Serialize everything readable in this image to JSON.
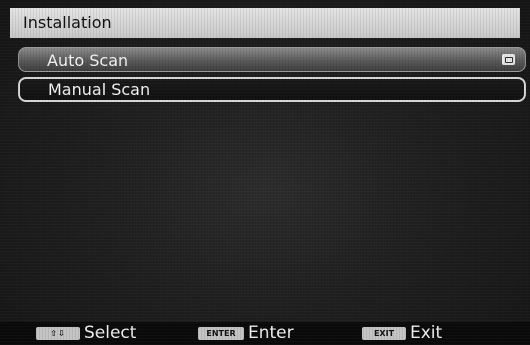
{
  "title": "Installation",
  "menu": {
    "items": [
      {
        "label": "Auto Scan",
        "has_submenu": true
      },
      {
        "label": "Manual Scan",
        "selected": true
      }
    ]
  },
  "footer": {
    "hints": [
      {
        "key": "⇧⇩",
        "label": "Select"
      },
      {
        "key": "ENTER",
        "label": "Enter"
      },
      {
        "key": "EXIT",
        "label": "Exit"
      }
    ]
  },
  "colors": {
    "title_bar": "#d6d6d6",
    "highlight": "#6e6e6e",
    "focus_border": "#d9d9d9",
    "background": "#222222"
  }
}
